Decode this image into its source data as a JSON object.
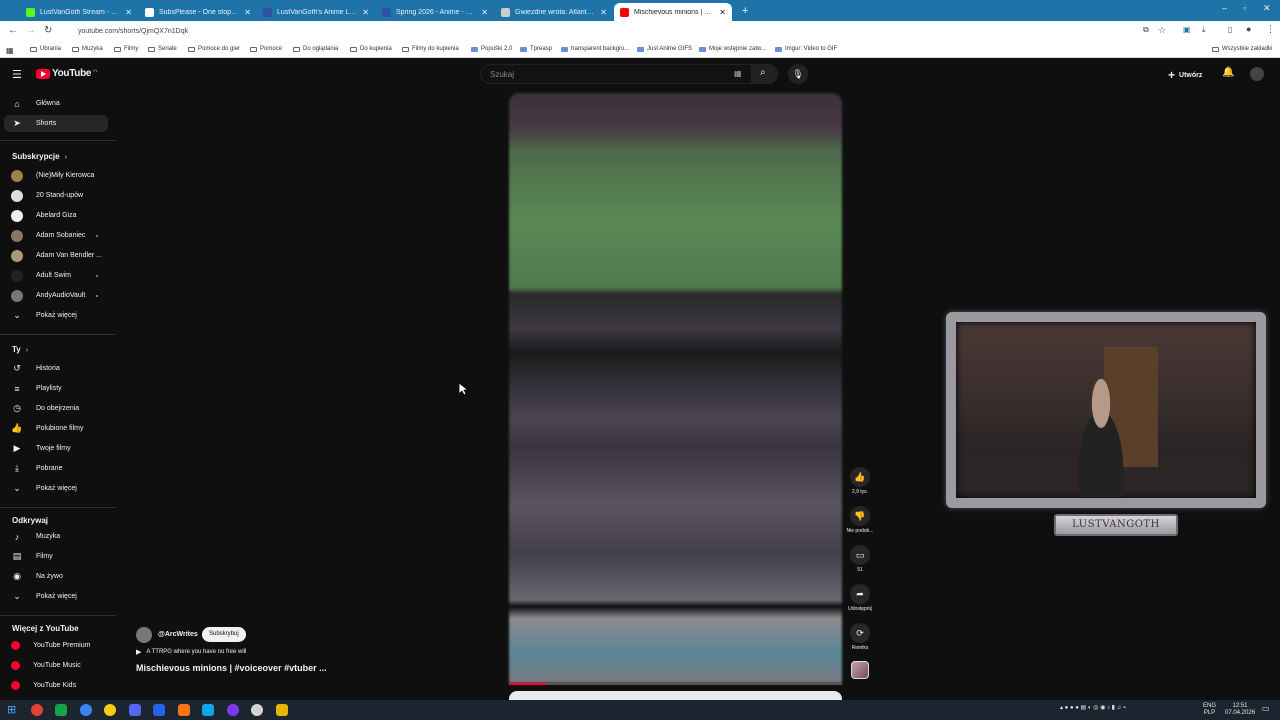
{
  "browser": {
    "tabs": [
      {
        "title": "LustVanGoth Stream - Watch Li",
        "color": "#53fc18",
        "active": false
      },
      {
        "title": "SubsPlease - One stop shop fo",
        "color": "#ffffff",
        "active": false
      },
      {
        "title": "LustVanGoth's Anime List - My",
        "color": "#2e51a2",
        "active": false
      },
      {
        "title": "Spring 2026 - Anime - MyAnim",
        "color": "#2e51a2",
        "active": false
      },
      {
        "title": "Gwiezdne wrota: Atlantyda | St",
        "color": "#cccccc",
        "active": false
      },
      {
        "title": "Mischievous minions | #vo",
        "color": "#ff0000",
        "active": true
      }
    ],
    "new_tab": "+",
    "url": "youtube.com/shorts/QjmQX7n1Dqk",
    "bookmarks": [
      {
        "label": "Ubrania",
        "icon": "folder-icon"
      },
      {
        "label": "Muzyka",
        "icon": "folder-icon"
      },
      {
        "label": "Filmy",
        "icon": "folder-icon"
      },
      {
        "label": "Seriale",
        "icon": "folder-icon"
      },
      {
        "label": "Pomoce do gier",
        "icon": "folder-icon"
      },
      {
        "label": "Pomoce",
        "icon": "folder-icon"
      },
      {
        "label": "Do oglądania",
        "icon": "folder-icon"
      },
      {
        "label": "Do kupienia",
        "icon": "folder-icon"
      },
      {
        "label": "Filmy do kupienia",
        "icon": "folder-icon"
      },
      {
        "label": "Popuški 2.0",
        "icon": "site-icon"
      },
      {
        "label": "Tpreasp",
        "icon": "site-icon"
      },
      {
        "label": "transparent backgro...",
        "icon": "site-icon"
      },
      {
        "label": "Just Anime GIFS",
        "icon": "site-icon"
      },
      {
        "label": "Moje wstępnie zatw...",
        "icon": "site-icon"
      },
      {
        "label": "Imgur: Video to GIF",
        "icon": "site-icon"
      }
    ],
    "all_bookmarks": "Wszystkie zakładki"
  },
  "youtube": {
    "logo": "YouTube",
    "region": "PL",
    "search_placeholder": "Szukaj",
    "create_label": "Utwórz",
    "sidebar": {
      "main": [
        {
          "label": "Główna",
          "icon": "home-icon"
        },
        {
          "label": "Shorts",
          "icon": "shorts-icon",
          "active": true
        }
      ],
      "subs_header": "Subskrypcje",
      "subscriptions": [
        {
          "label": "(Nie)Miły Kierowca",
          "color": "#a08050",
          "dot": false
        },
        {
          "label": "20 Stand-upów",
          "color": "#dddddd",
          "dot": false
        },
        {
          "label": "Abelard Giza",
          "color": "#eeeeee",
          "dot": false
        },
        {
          "label": "Adam Sobaniec",
          "color": "#887766",
          "dot": true
        },
        {
          "label": "Adam Van Bendler ...",
          "color": "#aa9977",
          "dot": false
        },
        {
          "label": "Adult Swim",
          "color": "#222222",
          "dot": true
        },
        {
          "label": "AndyAudioVault",
          "color": "#777777",
          "dot": true
        }
      ],
      "subs_more": "Pokaż więcej",
      "you_header": "Ty",
      "you_items": [
        {
          "label": "Historia",
          "icon": "history-icon"
        },
        {
          "label": "Playlisty",
          "icon": "playlist-icon"
        },
        {
          "label": "Do obejrzenia",
          "icon": "watch-later-icon"
        },
        {
          "label": "Polubione filmy",
          "icon": "like-icon"
        },
        {
          "label": "Twoje filmy",
          "icon": "your-videos-icon"
        },
        {
          "label": "Pobrane",
          "icon": "download-icon"
        },
        {
          "label": "Pokaż więcej",
          "icon": "chevron-down-icon"
        }
      ],
      "explore_header": "Odkrywaj",
      "explore_items": [
        {
          "label": "Muzyka",
          "icon": "music-icon"
        },
        {
          "label": "Filmy",
          "icon": "film-icon"
        },
        {
          "label": "Na żywo",
          "icon": "live-icon"
        },
        {
          "label": "Pokaż więcej",
          "icon": "chevron-down-icon"
        }
      ],
      "more_header": "Więcej z YouTube",
      "more_items": [
        {
          "label": "YouTube Premium",
          "color": "#ff0033"
        },
        {
          "label": "YouTube Music",
          "color": "#ff0033"
        },
        {
          "label": "YouTube Kids",
          "color": "#ff0033"
        }
      ]
    },
    "short": {
      "channel": "@ArcWrites",
      "subscribe_label": "Subskrybuj",
      "description": "A TTRPG where you have no free will",
      "title": "Mischievous minions | #voiceover #vtuber ...",
      "progress": 0.11,
      "actions": [
        {
          "icon": "thumb-up-icon",
          "label": "2,9 tys."
        },
        {
          "icon": "thumb-down-icon",
          "label": "Nie podob..."
        },
        {
          "icon": "comment-icon",
          "label": "51"
        },
        {
          "icon": "share-icon",
          "label": "Udostępnij"
        },
        {
          "icon": "remix-icon",
          "label": "Remiks"
        }
      ]
    }
  },
  "overlay": {
    "nameplate": "LUSTVANGOTH"
  },
  "taskbar": {
    "lang_top": "ENG",
    "lang_bottom": "PLP",
    "time": "12:51",
    "date": "07.04.2026"
  }
}
